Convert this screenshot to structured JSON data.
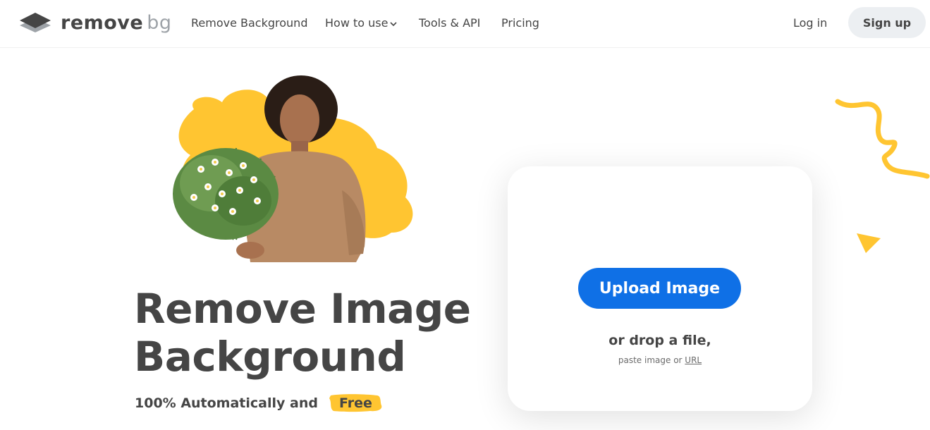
{
  "brand": {
    "name_main": "remove",
    "name_suffix": "bg"
  },
  "nav": {
    "items": [
      {
        "label": "Remove Background"
      },
      {
        "label": "How to use"
      },
      {
        "label": "Tools & API"
      },
      {
        "label": "Pricing"
      }
    ],
    "login_label": "Log in",
    "signup_label": "Sign up"
  },
  "hero": {
    "title_line1": "Remove Image",
    "title_line2": "Background",
    "subtitle": "100% Automatically and",
    "highlight": "Free"
  },
  "upload": {
    "button_label": "Upload Image",
    "drop_text": "or drop a file,",
    "paste_prefix": "paste image or",
    "url_label": "URL"
  },
  "colors": {
    "accent_blue": "#0f70e6",
    "accent_yellow": "#ffc531",
    "text_dark": "#454545"
  }
}
